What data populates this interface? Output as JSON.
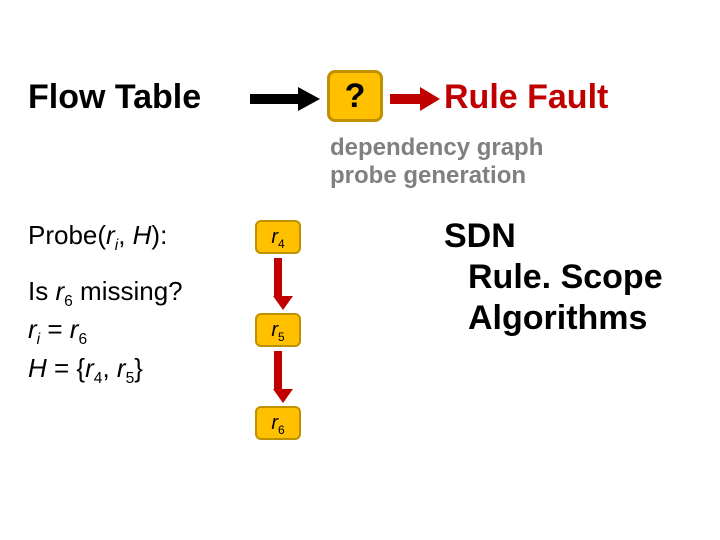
{
  "top": {
    "flow_table": "Flow Table",
    "qmark": "?",
    "rule_fault": "Rule Fault"
  },
  "subtitle": {
    "line1": "dependency graph",
    "line2": "probe generation"
  },
  "probe": {
    "heading_prefix": "Probe(",
    "heading_arg_r": "r",
    "heading_arg_sub": "i",
    "heading_sep": ", ",
    "heading_arg_H": "H",
    "heading_suffix": "):",
    "q_line_a": "Is ",
    "q_line_r": "r",
    "q_line_sub": "6",
    "q_line_b": " missing?",
    "assign_ri_r": "r",
    "assign_ri_sub": "i",
    "assign_eq": " = ",
    "assign_r6_r": "r",
    "assign_r6_sub": "6",
    "assign_H_lhs": "H",
    "assign_H_eq": " = {",
    "assign_H_r4_r": "r",
    "assign_H_r4_sub": "4",
    "assign_H_sep": ", ",
    "assign_H_r5_r": "r",
    "assign_H_r5_sub": "5",
    "assign_H_close": "}"
  },
  "rules": {
    "r4_r": "r",
    "r4_sub": "4",
    "r5_r": "r",
    "r5_sub": "5",
    "r6_r": "r",
    "r6_sub": "6"
  },
  "sdn": {
    "line1": "SDN",
    "line2": "Rule. Scope",
    "line3": "Algorithms"
  },
  "colors": {
    "accent_yellow": "#ffc000",
    "accent_yellow_border": "#bf9000",
    "red": "#c00000",
    "grey": "#808080"
  }
}
